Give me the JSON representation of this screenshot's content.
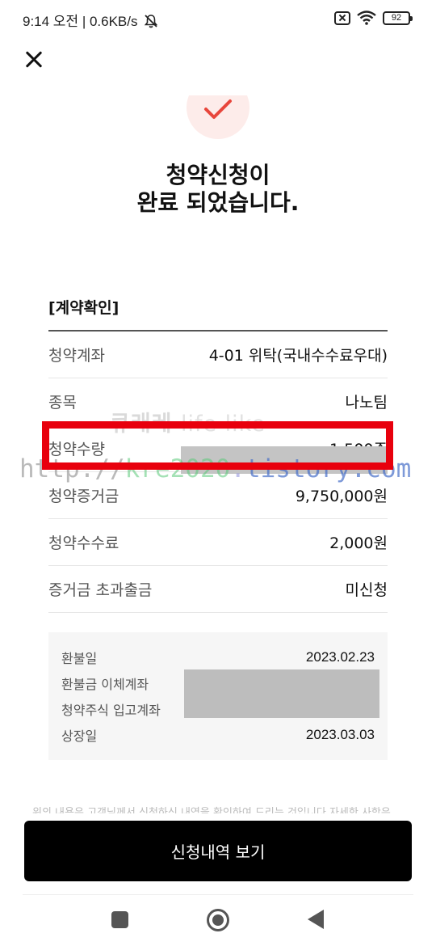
{
  "status_bar": {
    "time_speed": "9:14 오전 | 0.6KB/s",
    "battery": "92"
  },
  "header": {
    "title_line1": "청약신청이",
    "title_line2": "완료 되었습니다."
  },
  "contract": {
    "section_title": "[계약확인]",
    "rows": [
      {
        "label": "청약계좌",
        "value": "4-01 위탁(국내수수료우대)"
      },
      {
        "label": "종목",
        "value": "나노팀"
      },
      {
        "label": "청약수량",
        "value": "1,500주"
      },
      {
        "label": "청약증거금",
        "value": "9,750,000원"
      },
      {
        "label": "청약수수료",
        "value": "2,000원"
      },
      {
        "label": "증거금 초과출금",
        "value": "미신청"
      }
    ]
  },
  "refund_info": {
    "rows": [
      {
        "label": "환불일",
        "value": "2023.02.23"
      },
      {
        "label": "환불금 이체계좌",
        "value": ""
      },
      {
        "label": "청약주식 입고계좌",
        "value": ""
      },
      {
        "label": "상장일",
        "value": "2023.03.03"
      }
    ]
  },
  "watermark": {
    "brand_kr": "큐래레",
    "brand_en": "life like",
    "url_prefix": "http://",
    "url_mid": "kre2020",
    "url_dot": ".",
    "url_suffix": "tistory.com"
  },
  "footer_note": "위의 내용은 고객님께서 신청하신 내역을 확인하여 드리는 것입니다 자세한 사항은",
  "primary_button": "신청내역 보기",
  "colors": {
    "highlight_box": "#e8000d",
    "check_accent": "#e8463c",
    "check_bg": "#fdecea",
    "button_bg": "#000000"
  }
}
